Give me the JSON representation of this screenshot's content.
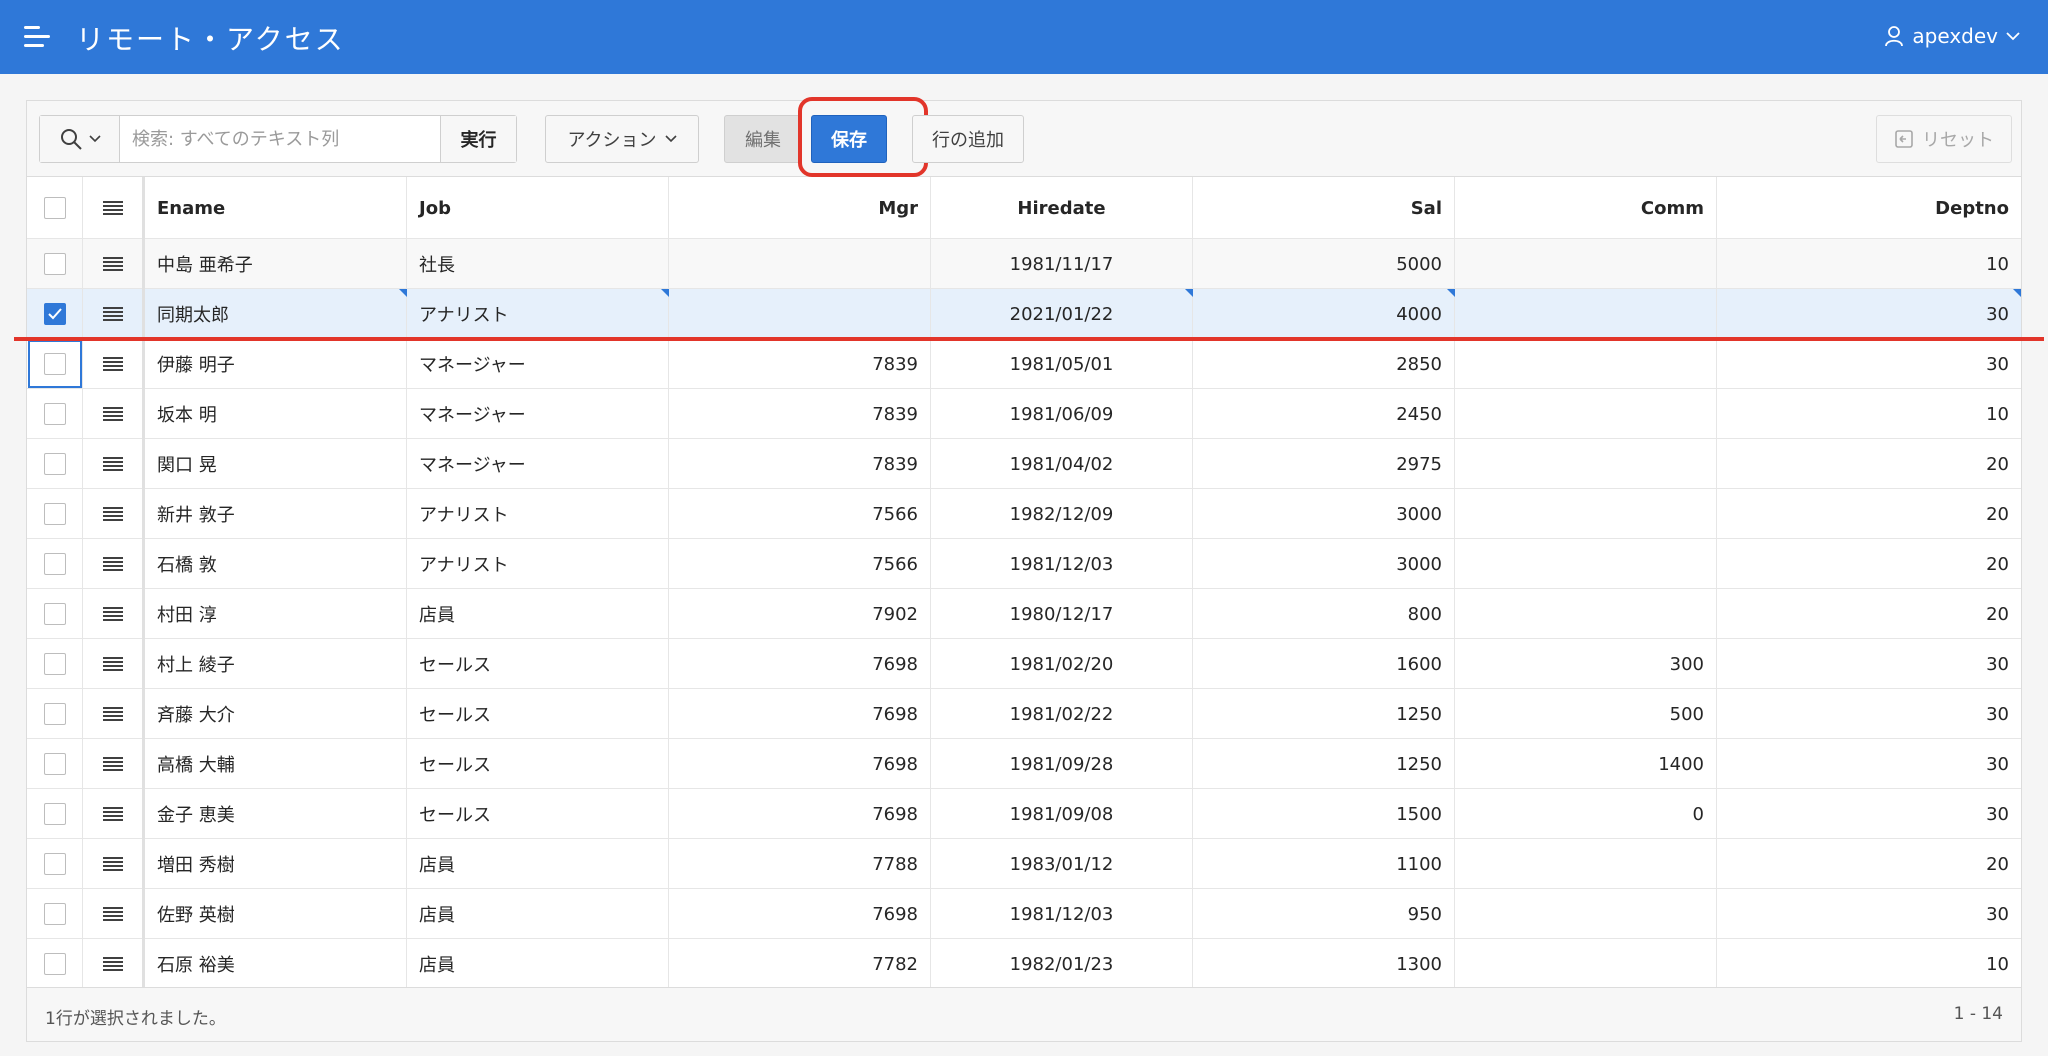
{
  "header": {
    "app_title": "リモート・アクセス",
    "user_name": "apexdev"
  },
  "toolbar": {
    "search_placeholder": "検索: すべてのテキスト列",
    "search_value": "",
    "run_label": "実行",
    "actions_label": "アクション",
    "edit_label": "編集",
    "save_label": "保存",
    "add_row_label": "行の追加",
    "reset_label": "リセット"
  },
  "columns": [
    "Ename",
    "Job",
    "Mgr",
    "Hiredate",
    "Sal",
    "Comm",
    "Deptno"
  ],
  "rows": [
    {
      "ename": "中島 亜希子",
      "job": "社長",
      "mgr": "",
      "hiredate": "1981/11/17",
      "sal": "5000",
      "comm": "",
      "deptno": "10",
      "checked": false
    },
    {
      "ename": "同期太郎",
      "job": "アナリスト",
      "mgr": "",
      "hiredate": "2021/01/22",
      "sal": "4000",
      "comm": "",
      "deptno": "30",
      "checked": true
    },
    {
      "ename": "伊藤 明子",
      "job": "マネージャー",
      "mgr": "7839",
      "hiredate": "1981/05/01",
      "sal": "2850",
      "comm": "",
      "deptno": "30",
      "checked": false
    },
    {
      "ename": "坂本 明",
      "job": "マネージャー",
      "mgr": "7839",
      "hiredate": "1981/06/09",
      "sal": "2450",
      "comm": "",
      "deptno": "10",
      "checked": false
    },
    {
      "ename": "関口 晃",
      "job": "マネージャー",
      "mgr": "7839",
      "hiredate": "1981/04/02",
      "sal": "2975",
      "comm": "",
      "deptno": "20",
      "checked": false
    },
    {
      "ename": "新井 敦子",
      "job": "アナリスト",
      "mgr": "7566",
      "hiredate": "1982/12/09",
      "sal": "3000",
      "comm": "",
      "deptno": "20",
      "checked": false
    },
    {
      "ename": "石橋 敦",
      "job": "アナリスト",
      "mgr": "7566",
      "hiredate": "1981/12/03",
      "sal": "3000",
      "comm": "",
      "deptno": "20",
      "checked": false
    },
    {
      "ename": "村田 淳",
      "job": "店員",
      "mgr": "7902",
      "hiredate": "1980/12/17",
      "sal": "800",
      "comm": "",
      "deptno": "20",
      "checked": false
    },
    {
      "ename": "村上 綾子",
      "job": "セールス",
      "mgr": "7698",
      "hiredate": "1981/02/20",
      "sal": "1600",
      "comm": "300",
      "deptno": "30",
      "checked": false
    },
    {
      "ename": "斉藤 大介",
      "job": "セールス",
      "mgr": "7698",
      "hiredate": "1981/02/22",
      "sal": "1250",
      "comm": "500",
      "deptno": "30",
      "checked": false
    },
    {
      "ename": "高橋 大輔",
      "job": "セールス",
      "mgr": "7698",
      "hiredate": "1981/09/28",
      "sal": "1250",
      "comm": "1400",
      "deptno": "30",
      "checked": false
    },
    {
      "ename": "金子 恵美",
      "job": "セールス",
      "mgr": "7698",
      "hiredate": "1981/09/08",
      "sal": "1500",
      "comm": "0",
      "deptno": "30",
      "checked": false
    },
    {
      "ename": "増田 秀樹",
      "job": "店員",
      "mgr": "7788",
      "hiredate": "1983/01/12",
      "sal": "1100",
      "comm": "",
      "deptno": "20",
      "checked": false
    },
    {
      "ename": "佐野 英樹",
      "job": "店員",
      "mgr": "7698",
      "hiredate": "1981/12/03",
      "sal": "950",
      "comm": "",
      "deptno": "30",
      "checked": false
    },
    {
      "ename": "石原 裕美",
      "job": "店員",
      "mgr": "7782",
      "hiredate": "1982/01/23",
      "sal": "1300",
      "comm": "",
      "deptno": "10",
      "checked": false
    }
  ],
  "footer": {
    "status_text": "1行が選択されました。",
    "pagination": "1 - 14"
  },
  "colors": {
    "brand": "#2f78d8",
    "highlight": "#e2352a"
  }
}
